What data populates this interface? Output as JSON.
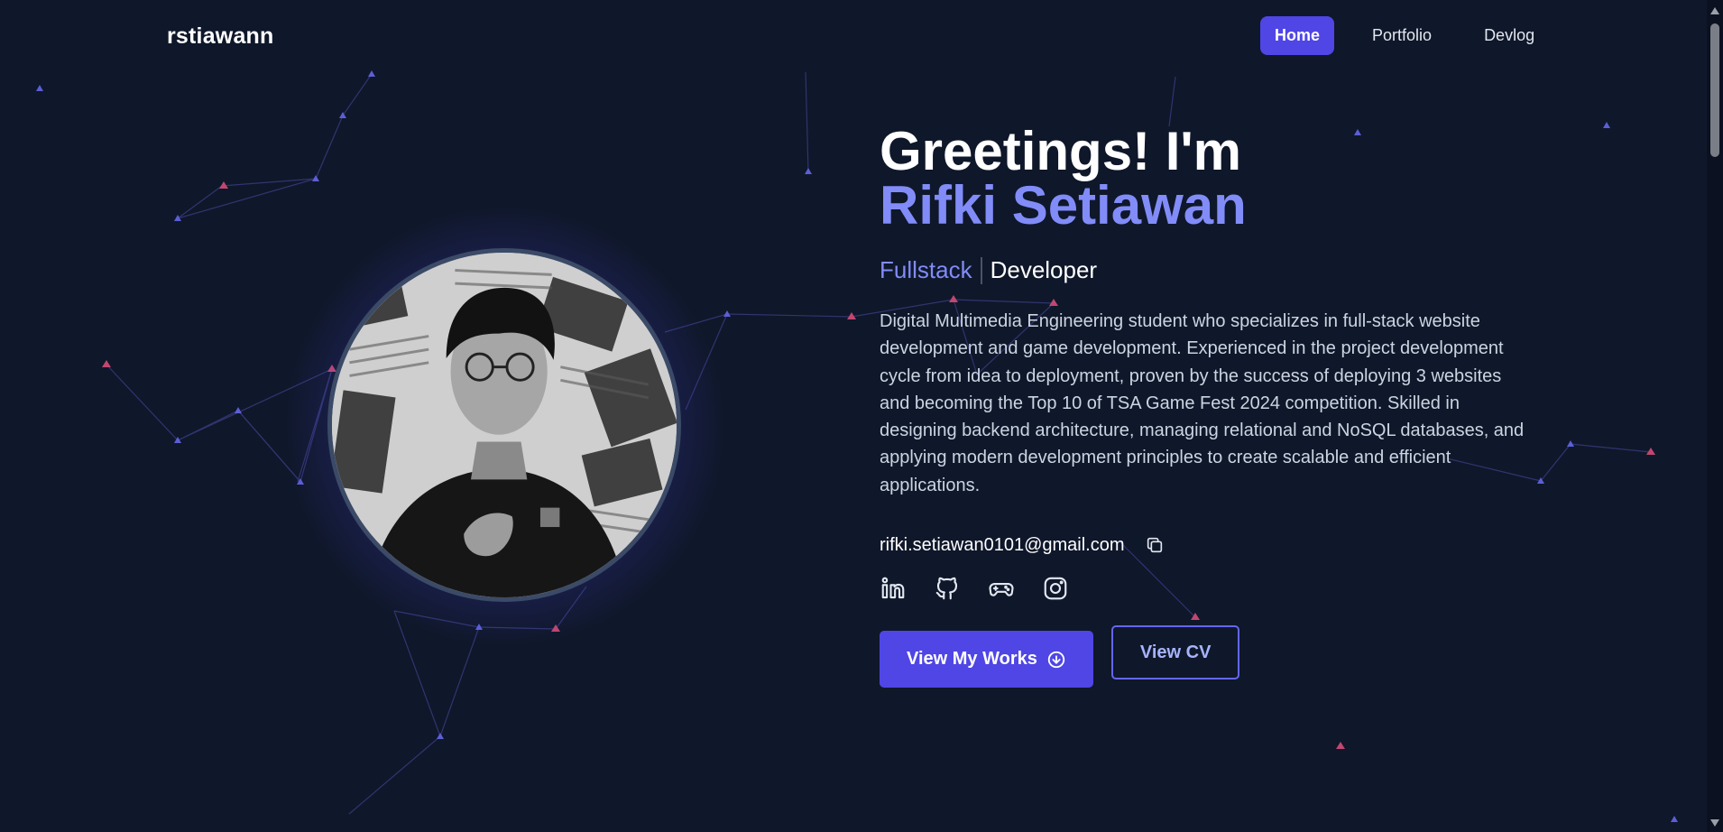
{
  "brand": "rstiawann",
  "nav": {
    "home": "Home",
    "portfolio": "Portfolio",
    "devlog": "Devlog",
    "active": "Home"
  },
  "hero": {
    "greeting": "Greetings! I'm",
    "name": "Rifki Setiawan",
    "role_primary": "Fullstack",
    "role_secondary": "Developer",
    "bio": "Digital Multimedia Engineering student who specializes in full-stack website development and game development. Experienced in the project development cycle from idea to deployment, proven by the success of deploying 3 websites and becoming the Top 10 of TSA Game Fest 2024 competition. Skilled in designing backend architecture, managing relational and NoSQL databases, and applying modern development principles to create scalable and efficient applications.",
    "email": "rifki.setiawan0101@gmail.com",
    "socials": [
      "linkedin-icon",
      "github-icon",
      "gamepad-icon",
      "instagram-icon"
    ],
    "cta_primary": "View My Works",
    "cta_secondary": "View CV"
  },
  "colors": {
    "background": "#0f172a",
    "accent": "#4f46e5",
    "accent_light": "#818cf8"
  }
}
